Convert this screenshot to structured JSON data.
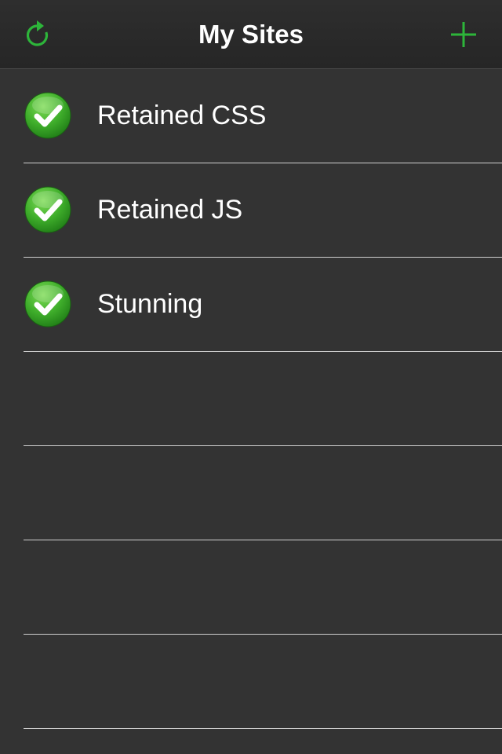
{
  "nav": {
    "title": "My Sites",
    "left_icon": "refresh-icon",
    "right_icon": "plus-icon",
    "accent_color": "#2db53a"
  },
  "sites": [
    {
      "name": "Retained CSS",
      "status_icon": "check-circle-icon",
      "status_color": "#3aaa2e"
    },
    {
      "name": "Retained JS",
      "status_icon": "check-circle-icon",
      "status_color": "#3aaa2e"
    },
    {
      "name": "Stunning",
      "status_icon": "check-circle-icon",
      "status_color": "#3aaa2e"
    }
  ],
  "theme": {
    "background": "#333333",
    "text": "#ffffff",
    "separator": "#cfcfcf"
  }
}
